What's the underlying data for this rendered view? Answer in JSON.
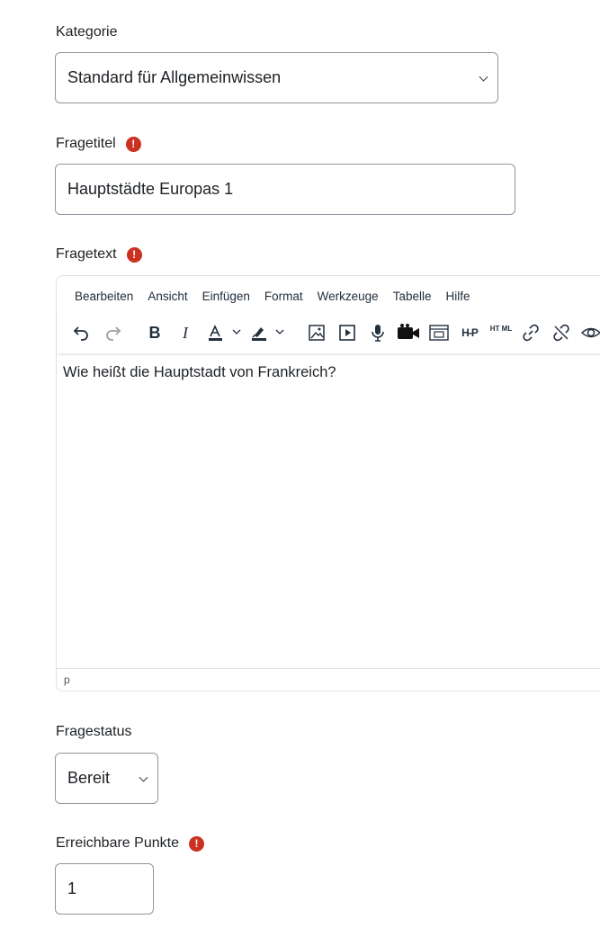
{
  "category": {
    "label": "Kategorie",
    "value": "Standard für Allgemeinwissen"
  },
  "question_title": {
    "label": "Fragetitel",
    "value": "Hauptstädte Europas 1",
    "required_icon": "!"
  },
  "question_text": {
    "label": "Fragetext",
    "required_icon": "!",
    "menu": [
      "Bearbeiten",
      "Ansicht",
      "Einfügen",
      "Format",
      "Werkzeuge",
      "Tabelle",
      "Hilfe"
    ],
    "toolbar_icons": [
      "undo-icon",
      "redo-icon",
      "bold-icon",
      "italic-icon",
      "text-color-icon",
      "highlight-icon",
      "image-icon",
      "media-icon",
      "microphone-icon",
      "video-camera-icon",
      "embed-icon",
      "h5p-icon",
      "html-icon",
      "link-icon",
      "unlink-icon",
      "preview-icon"
    ],
    "bold_glyph": "B",
    "italic_glyph": "I",
    "h5p_text": "H-P",
    "html_text": "HT ML",
    "content": "Wie heißt die Hauptstadt von Frankreich?",
    "status_path": "p"
  },
  "question_status": {
    "label": "Fragestatus",
    "value": "Bereit"
  },
  "default_mark": {
    "label": "Erreichbare Punkte",
    "value": "1",
    "required_icon": "!"
  },
  "colors": {
    "required": "#ca3120",
    "border": "#8f959e",
    "text": "#1d2125"
  }
}
